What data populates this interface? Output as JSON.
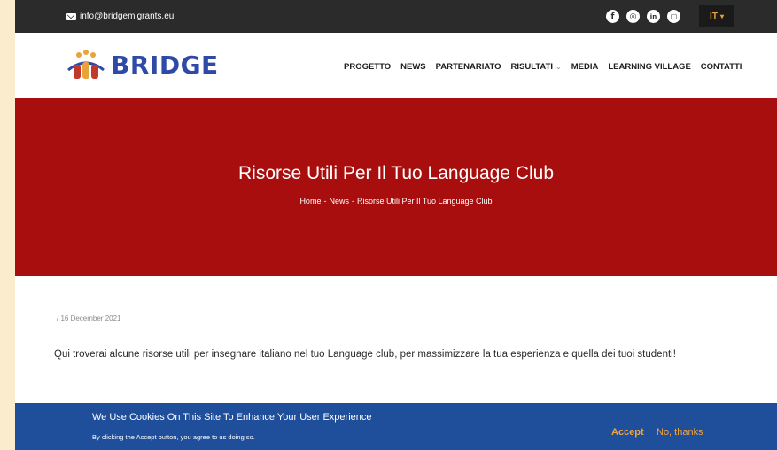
{
  "topbar": {
    "email": "info@bridgemigrants.eu",
    "social": [
      {
        "icon": "facebook-icon",
        "glyph": "f"
      },
      {
        "icon": "instagram-icon",
        "glyph": "◎"
      },
      {
        "icon": "linkedin-icon",
        "glyph": "in"
      },
      {
        "icon": "video-icon",
        "glyph": "▢"
      }
    ],
    "language": "IT",
    "language_arrow": "▾"
  },
  "header": {
    "logo_text": "BRIDGE",
    "nav": [
      {
        "label": "PROGETTO"
      },
      {
        "label": "NEWS"
      },
      {
        "label": "PARTENARIATO"
      },
      {
        "label": "RISULTATI",
        "dropdown": "⌄"
      },
      {
        "label": "MEDIA"
      },
      {
        "label": "LEARNING VILLAGE"
      },
      {
        "label": "CONTATTI"
      }
    ]
  },
  "hero": {
    "title": "Risorse Utili Per Il Tuo Language Club",
    "breadcrumb": [
      "Home",
      "-",
      "News",
      "-",
      "Risorse Utili Per Il Tuo Language Club"
    ]
  },
  "post": {
    "date": "/ 16 December 2021",
    "intro": "Qui troverai alcune risorse utili per insegnare italiano nel tuo Language club, per massimizzare la tua esperienza e quella dei tuoi studenti!"
  },
  "cookie": {
    "title": "We Use Cookies On This Site To Enhance Your User Experience",
    "subtitle": "By clicking the Accept button, you agree to us doing so.",
    "accept": "Accept",
    "decline": "No, thanks"
  },
  "colors": {
    "topbar": "#2b2b2b",
    "brand_blue": "#2f4aa6",
    "hero_red": "#a80e0e",
    "cookie_blue": "#1f4e9b",
    "accent_orange": "#f0a43a"
  }
}
